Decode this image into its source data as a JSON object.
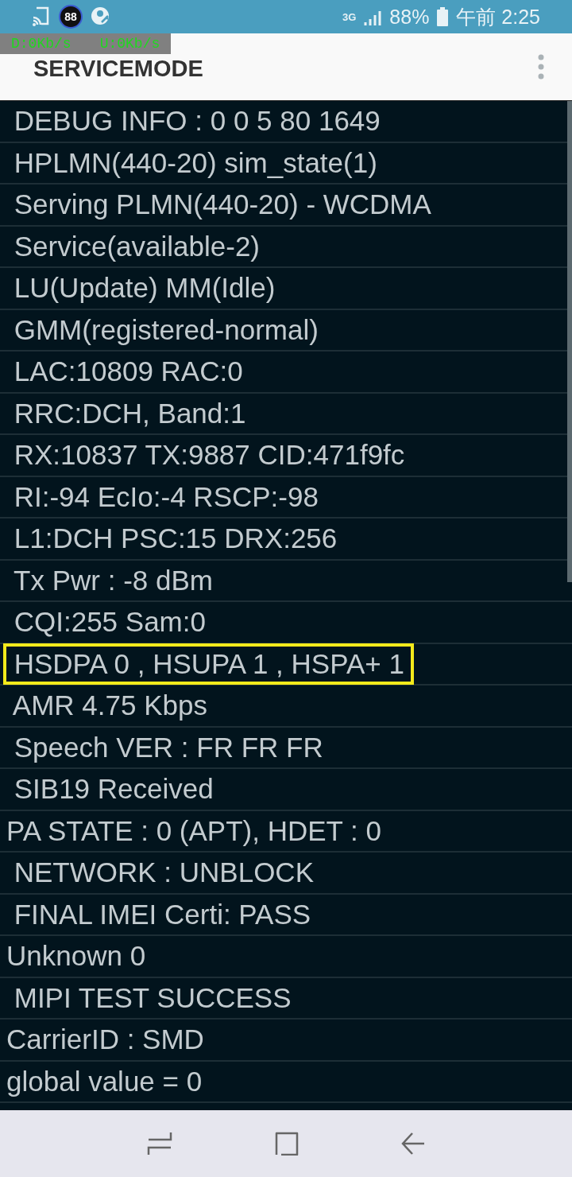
{
  "status_bar": {
    "badge": "88",
    "network": "3G",
    "battery": "88%",
    "time": "午前 2:25"
  },
  "speed_overlay": {
    "download": "D:0Kb/s",
    "upload": "U:0Kb/s"
  },
  "app_bar": {
    "title": "SERVICEMODE"
  },
  "rows": [
    {
      "text": " DEBUG INFO : 0 0 5 80 1649",
      "highlighted": false
    },
    {
      "text": " HPLMN(440-20) sim_state(1)",
      "highlighted": false
    },
    {
      "text": " Serving PLMN(440-20) - WCDMA",
      "highlighted": false
    },
    {
      "text": " Service(available-2)",
      "highlighted": false
    },
    {
      "text": " LU(Update) MM(Idle)",
      "highlighted": false
    },
    {
      "text": " GMM(registered-normal)",
      "highlighted": false
    },
    {
      "text": " LAC:10809 RAC:0",
      "highlighted": false
    },
    {
      "text": " RRC:DCH, Band:1",
      "highlighted": false
    },
    {
      "text": " RX:10837 TX:9887 CID:471f9fc",
      "highlighted": false
    },
    {
      "text": " RI:-94 EcIo:-4 RSCP:-98",
      "highlighted": false
    },
    {
      "text": " L1:DCH PSC:15 DRX:256",
      "highlighted": false
    },
    {
      "text": " Tx Pwr : -8 dBm",
      "highlighted": false
    },
    {
      "text": " CQI:255 Sam:0",
      "highlighted": false
    },
    {
      "text": " HSDPA 0 , HSUPA 1 , HSPA+ 1",
      "highlighted": true
    },
    {
      "text": " AMR 4.75 Kbps",
      "highlighted": false
    },
    {
      "text": " Speech VER : FR FR FR",
      "highlighted": false
    },
    {
      "text": " SIB19 Received",
      "highlighted": false
    },
    {
      "text": "PA STATE : 0 (APT), HDET : 0",
      "highlighted": false
    },
    {
      "text": " NETWORK : UNBLOCK",
      "highlighted": false
    },
    {
      "text": " FINAL IMEI Certi: PASS",
      "highlighted": false
    },
    {
      "text": "Unknown 0",
      "highlighted": false
    },
    {
      "text": " MIPI TEST SUCCESS",
      "highlighted": false
    },
    {
      "text": "CarrierID : SMD",
      "highlighted": false
    },
    {
      "text": "global value = 0",
      "highlighted": false
    }
  ]
}
